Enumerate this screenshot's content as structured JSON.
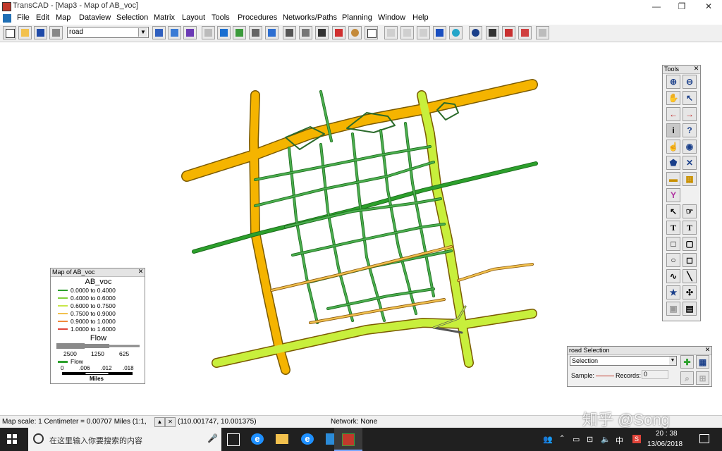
{
  "window": {
    "title": "TransCAD - [Map3 - Map of AB_voc]",
    "min": "—",
    "max": "❐",
    "close": "✕"
  },
  "menu": [
    "File",
    "Edit",
    "Map",
    "Dataview",
    "Selection",
    "Matrix",
    "Layout",
    "Tools",
    "Procedures",
    "Networks/Paths",
    "Planning",
    "Window",
    "Help"
  ],
  "toolbar": {
    "layer": "road"
  },
  "legend": {
    "title": "Map of AB_voc",
    "heading": "AB_voc",
    "classes": [
      {
        "label": "0.0000 to 0.4000",
        "color": "#2ca02c"
      },
      {
        "label": "0.4000 to 0.6000",
        "color": "#7fd13b"
      },
      {
        "label": "0.6000 to 0.7500",
        "color": "#c8e64a"
      },
      {
        "label": "0.7500 to 0.9000",
        "color": "#f2c14e"
      },
      {
        "label": "0.9000 to 1.0000",
        "color": "#f08a3a"
      },
      {
        "label": "1.0000 to 1.6000",
        "color": "#e0443a"
      }
    ],
    "flow_heading": "Flow",
    "flow_values": [
      "2500",
      "1250",
      "625"
    ],
    "flow_item": "Flow",
    "scale_ticks": [
      "0",
      ".006",
      ".012",
      ".018"
    ],
    "scale_unit": "Miles"
  },
  "tools": {
    "title": "Tools"
  },
  "selection": {
    "title": "road Selection",
    "set": "Selection",
    "sample_label": "Sample:",
    "records_label": "Records:",
    "records": "0"
  },
  "status": {
    "scale": "Map scale: 1 Centimeter = 0.00707 Miles (1:1,",
    "coords": "(110.001747, 10.001375)",
    "network": "Network: None"
  },
  "taskbar": {
    "search_placeholder": "在这里输入你要搜索的内容",
    "time": "20 : 38",
    "date": "13/06/2018",
    "ime": "中",
    "watermark": "知乎 @Song"
  },
  "colors": {
    "orange": "#f5b400",
    "orange_dark": "#c88600",
    "yellowgreen": "#c8ef3c",
    "green": "#2ca02c"
  }
}
